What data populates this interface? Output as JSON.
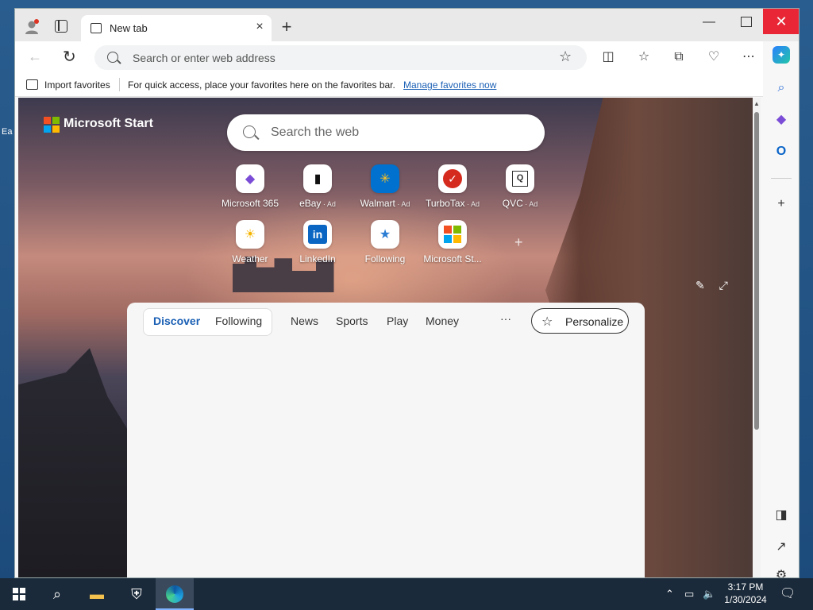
{
  "desktop": {
    "label": "Ea"
  },
  "titlebar": {
    "tab_title": "New tab",
    "tab_close": "×",
    "new_tab": "+",
    "minimize": "—",
    "close": "✕"
  },
  "toolbar": {
    "address_placeholder": "Search or enter web address"
  },
  "favorites_bar": {
    "import_label": "Import favorites",
    "hint_text": "For quick access, place your favorites here on the favorites bar.",
    "manage_link": "Manage favorites now"
  },
  "start_page": {
    "brand": "Microsoft Start",
    "search_placeholder": "Search the web",
    "tiles": [
      {
        "label": "Microsoft 365",
        "ad": ""
      },
      {
        "label": "eBay",
        "ad": " · Ad"
      },
      {
        "label": "Walmart",
        "ad": " · Ad"
      },
      {
        "label": "TurboTax",
        "ad": " · Ad"
      },
      {
        "label": "QVC",
        "ad": " · Ad"
      },
      {
        "label": "Weather",
        "ad": ""
      },
      {
        "label": "LinkedIn",
        "ad": ""
      },
      {
        "label": "Following",
        "ad": ""
      },
      {
        "label": "Microsoft St...",
        "ad": ""
      }
    ],
    "feed_tabs": [
      "Discover",
      "Following",
      "News",
      "Sports",
      "Play",
      "Money"
    ],
    "feed_more": "···",
    "personalize_label": "Personalize"
  },
  "taskbar": {
    "time": "3:17 PM",
    "date": "1/30/2024"
  },
  "colors": {
    "accent": "#1a5fb4",
    "close_red": "#e81123"
  }
}
